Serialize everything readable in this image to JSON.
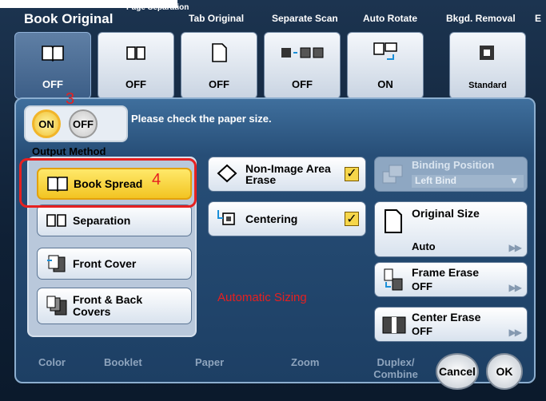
{
  "tabs": {
    "title": "Book Original",
    "items": [
      {
        "label": "Page Separation",
        "value": "OFF"
      },
      {
        "label": "Tab Original",
        "value": "OFF"
      },
      {
        "label": "Separate Scan",
        "value": "OFF"
      },
      {
        "label": "Auto Rotate",
        "value": "ON"
      },
      {
        "label": "Bkgd. Removal",
        "value": "Standard"
      },
      {
        "label": "E",
        "value": ""
      }
    ],
    "book_original_value": "OFF"
  },
  "dialog": {
    "message": "Please check the paper size.",
    "on_label": "ON",
    "off_label": "OFF",
    "output_method_label": "Output Method",
    "output_methods": [
      "Book Spread",
      "Separation",
      "Front Cover",
      "Front & Back Covers"
    ],
    "non_image_erase": "Non-Image Area Erase",
    "centering": "Centering",
    "binding_position_label": "Binding Position",
    "binding_position_value": "Left Bind",
    "original_size_label": "Original Size",
    "original_size_value": "Auto",
    "frame_erase_label": "Frame Erase",
    "frame_erase_value": "OFF",
    "center_erase_label": "Center Erase",
    "center_erase_value": "OFF",
    "auto_sizing_note": "Automatic Sizing"
  },
  "bottom": {
    "tabs": [
      "Color",
      "Booklet",
      "Paper",
      "Zoom",
      "Duplex/ Combine"
    ],
    "cancel_label": "Cancel",
    "ok_label": "OK"
  },
  "annotations": {
    "step3": "3",
    "step4": "4"
  },
  "colors": {
    "accent_yellow": "#f2c422",
    "annotation_red": "#e62020",
    "panel_blue": "#274e77"
  }
}
